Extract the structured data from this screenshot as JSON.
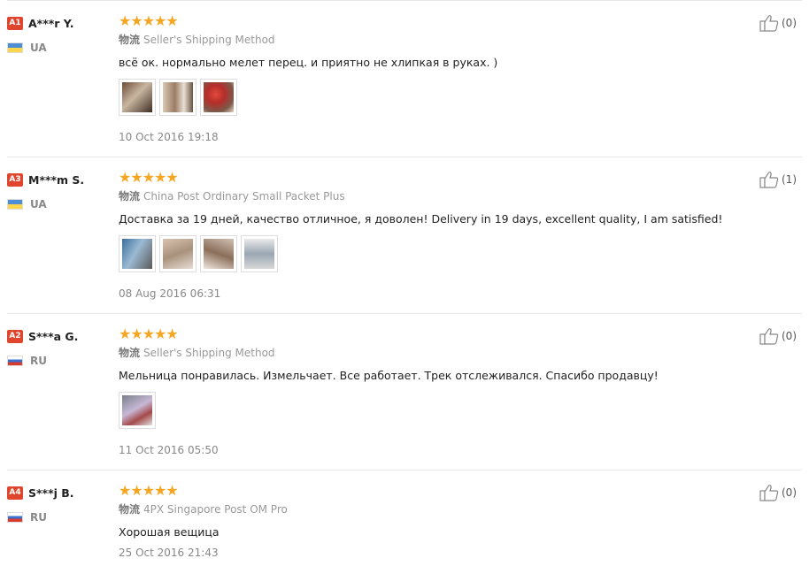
{
  "reviews": [
    {
      "badge": "A1",
      "name": "A***r Y.",
      "country_code": "UA",
      "flag": "ua",
      "stars": "★★★★★",
      "shipping_label": "物流",
      "shipping": "Seller's Shipping Method",
      "text": "всё ок. нормально мелет перец. и приятно не хлипкая в руках. )",
      "photo_count": 3,
      "date": "10 Oct 2016 19:18",
      "likes": "(0)"
    },
    {
      "badge": "A3",
      "name": "M***m S.",
      "country_code": "UA",
      "flag": "ua",
      "stars": "★★★★★",
      "shipping_label": "物流",
      "shipping": "China Post Ordinary Small Packet Plus",
      "text": "Доставка за 19 дней, качество отличное, я доволен! Delivery in 19 days, excellent quality, I am satisfied!",
      "photo_count": 4,
      "date": "08 Aug 2016 06:31",
      "likes": "(1)"
    },
    {
      "badge": "A2",
      "name": "S***a G.",
      "country_code": "RU",
      "flag": "ru",
      "stars": "★★★★★",
      "shipping_label": "物流",
      "shipping": "Seller's Shipping Method",
      "text": "Мельница понравилась. Измельчает. Все работает. Трек отслеживался. Спасибо продавцу!",
      "photo_count": 1,
      "date": "11 Oct 2016 05:50",
      "likes": "(0)"
    },
    {
      "badge": "A4",
      "name": "S***j B.",
      "country_code": "RU",
      "flag": "ru",
      "stars": "★★★★★",
      "shipping_label": "物流",
      "shipping": "4PX Singapore Post OM Pro",
      "text": "Хорошая вещица",
      "photo_count": 0,
      "date": "25 Oct 2016 21:43",
      "likes": "(0)"
    }
  ],
  "icons": {
    "like": "thumbs-up-icon",
    "flag_ua": "ukraine-flag-icon",
    "flag_ru": "russia-flag-icon",
    "stars": "star-rating-icon"
  },
  "colors": {
    "badge": "#e0462d",
    "stars": "#f5a623",
    "muted_text": "#888888",
    "divider": "#e8e8e8"
  }
}
